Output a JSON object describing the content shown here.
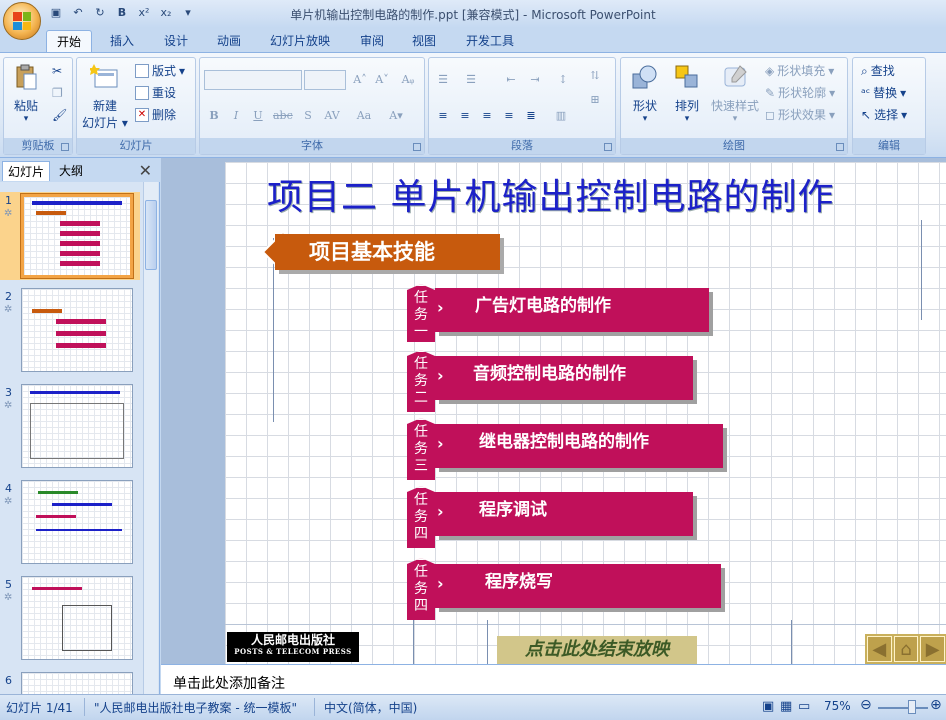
{
  "window": {
    "title": "单片机输出控制电路的制作.ppt [兼容模式] - Microsoft PowerPoint"
  },
  "tabs": [
    "开始",
    "插入",
    "设计",
    "动画",
    "幻灯片放映",
    "审阅",
    "视图",
    "开发工具"
  ],
  "ribbon": {
    "clipboard": {
      "label": "剪贴板",
      "paste": "粘贴"
    },
    "slides": {
      "label": "幻灯片",
      "new_slide": "新建\n幻灯片",
      "new_slide_l1": "新建",
      "new_slide_l2": "幻灯片",
      "layout": "版式",
      "reset": "重设",
      "delete": "删除"
    },
    "font": {
      "label": "字体"
    },
    "paragraph": {
      "label": "段落"
    },
    "drawing": {
      "label": "绘图",
      "shapes": "形状",
      "arrange": "排列",
      "quick_styles": "快速样式",
      "shape_fill": "形状填充",
      "shape_outline": "形状轮廓",
      "shape_effects": "形状效果"
    },
    "editing": {
      "label": "编辑",
      "find": "查找",
      "replace": "替换",
      "select": "选择"
    }
  },
  "left_pane": {
    "tab_slides": "幻灯片",
    "tab_outline": "大纲",
    "slide_numbers": [
      "1",
      "2",
      "3",
      "4",
      "5",
      "6"
    ]
  },
  "slide": {
    "title": "项目二  单片机输出控制电路的制作",
    "skill_heading": "项目基本技能",
    "tasks": [
      {
        "tag": [
          "任",
          "务",
          "一"
        ],
        "text": "广告灯电路的制作"
      },
      {
        "tag": [
          "任",
          "务",
          "二"
        ],
        "text": "音频控制电路的制作"
      },
      {
        "tag": [
          "任",
          "务",
          "三"
        ],
        "text": "继电器控制电路的制作"
      },
      {
        "tag": [
          "任",
          "务",
          "四"
        ],
        "text": "程序调试"
      },
      {
        "tag": [
          "任",
          "务",
          "四"
        ],
        "text": "程序烧写"
      }
    ],
    "publisher_cn": "人民邮电出版社",
    "publisher_en": "POSTS & TELECOM PRESS",
    "end_show": "点击此处结束放映"
  },
  "notes": {
    "placeholder": "单击此处添加备注"
  },
  "status": {
    "slide_counter": "幻灯片 1/41",
    "theme": "\"人民邮电出版社电子教案 - 统一模板\"",
    "language": "中文(简体，中国)",
    "zoom": "75%"
  },
  "colors": {
    "title_blue": "#1c21c8",
    "skill_orange": "#c75a0d",
    "task_magenta": "#c0105a"
  }
}
